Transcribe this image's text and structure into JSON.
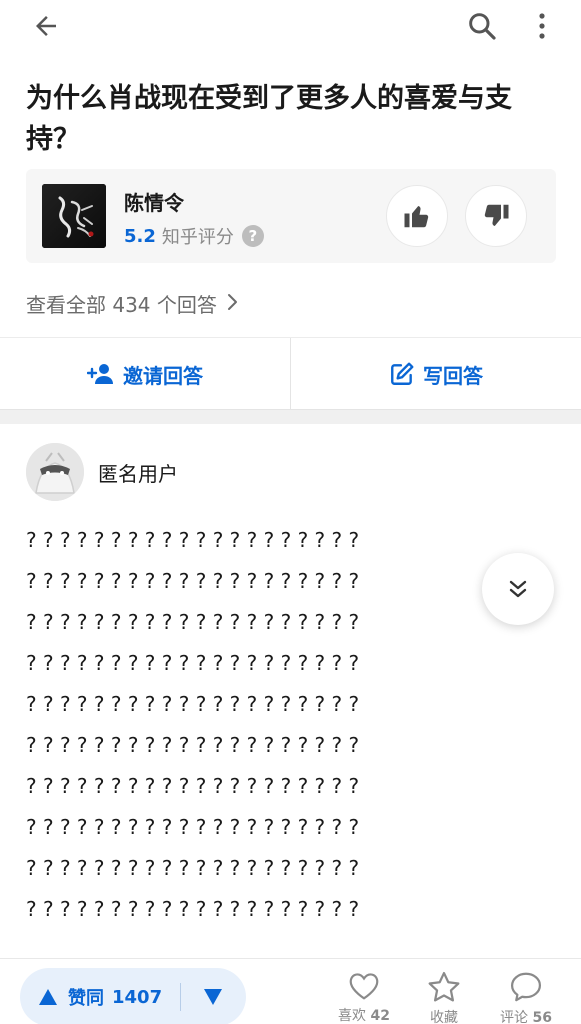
{
  "question": {
    "title": "为什么肖战现在受到了更多人的喜爱与支持？"
  },
  "card": {
    "name": "陈情令",
    "score": "5.2",
    "score_label": "知乎评分",
    "help_icon_text": "?"
  },
  "answers": {
    "view_all": "查看全部 434 个回答"
  },
  "actions": {
    "invite": "邀请回答",
    "write": "写回答"
  },
  "answer": {
    "author": "匿名用户",
    "lines": [
      "? ? ? ? ? ? ? ? ? ? ? ? ? ? ? ? ? ? ? ?",
      "? ? ? ? ? ? ? ? ? ? ? ? ? ? ? ? ? ? ? ?",
      "? ? ? ? ? ? ? ? ? ? ? ? ? ? ? ? ? ? ? ?",
      "? ? ? ? ? ? ? ? ? ? ? ? ? ? ? ? ? ? ? ?",
      "? ? ? ? ? ? ? ? ? ? ? ? ? ? ? ? ? ? ? ?",
      "? ? ? ? ? ? ? ? ? ? ? ? ? ? ? ? ? ? ? ?",
      "? ? ? ? ? ? ? ? ? ? ? ? ? ? ? ? ? ? ? ?",
      "? ? ? ? ? ? ? ? ? ? ? ? ? ? ? ? ? ? ? ?",
      "? ? ? ? ? ? ? ? ? ? ? ? ? ? ? ? ? ? ? ?",
      "? ? ? ? ? ? ? ? ? ? ? ? ? ? ? ? ? ? ? ?"
    ]
  },
  "bottom": {
    "vote_label": "赞同",
    "vote_count": "1407",
    "like_label": "喜欢",
    "like_count": "42",
    "fav_label": "收藏",
    "comment_label": "评论",
    "comment_count": "56"
  },
  "icons": {
    "back": "back-arrow-icon",
    "search": "search-icon",
    "more": "more-vertical-icon",
    "thumb_up": "thumb-up-icon",
    "thumb_down": "thumb-down-icon",
    "chevron_right": "chevron-right-icon",
    "invite": "add-person-icon",
    "write": "edit-icon",
    "expand": "double-chevron-down-icon",
    "vote_up": "triangle-up-icon",
    "vote_down": "triangle-down-icon",
    "like": "heart-icon",
    "fav": "star-icon",
    "comment": "speech-bubble-icon"
  },
  "colors": {
    "accent": "#0a66d4",
    "vote_bg": "#e7f0fb",
    "muted": "#8a8a8a",
    "card_bg": "#f6f6f6"
  }
}
